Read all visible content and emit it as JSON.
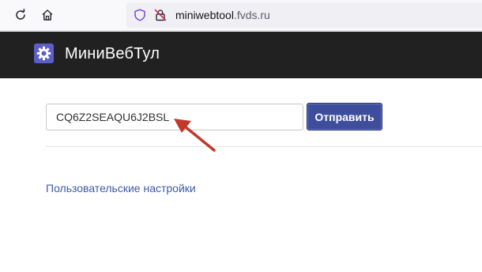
{
  "browser": {
    "url_host": "miniwebtool",
    "url_rest": ".fvds.ru"
  },
  "header": {
    "brand": "МиниВебТул",
    "logo_icon": "gear-icon",
    "background": "#212121"
  },
  "form": {
    "code_value": "CQ6Z2SEAQU6J2BSL",
    "submit_label": "Отправить",
    "accent": "#3e4e9c"
  },
  "links": {
    "settings": "Пользовательские настройки"
  },
  "annotation": {
    "arrow_icon": "red-arrow-icon",
    "arrow_color": "#c0392b"
  }
}
